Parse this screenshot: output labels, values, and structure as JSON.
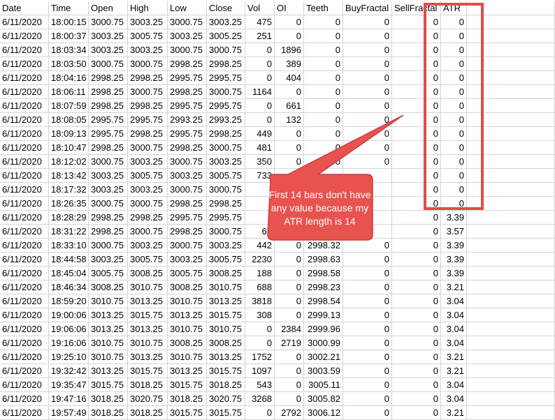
{
  "sheet": {
    "headers": [
      "Date",
      "Time",
      "Open",
      "High",
      "Low",
      "Close",
      "Vol",
      "OI",
      "Teeth",
      "BuyFractal",
      "SellFractal",
      "ATR"
    ],
    "rows": [
      [
        "6/11/2020",
        "18:00:15",
        "3000.75",
        "3003.25",
        "3000.75",
        "3003.25",
        "475",
        "0",
        "0",
        "0",
        "0",
        "0"
      ],
      [
        "6/11/2020",
        "18:00:37",
        "3003.25",
        "3005.75",
        "3003.25",
        "3005.25",
        "251",
        "0",
        "0",
        "0",
        "0",
        "0"
      ],
      [
        "6/11/2020",
        "18:03:34",
        "3003.25",
        "3003.25",
        "3000.75",
        "3000.75",
        "0",
        "1896",
        "0",
        "0",
        "0",
        "0"
      ],
      [
        "6/11/2020",
        "18:03:50",
        "3000.75",
        "3000.75",
        "2998.25",
        "2998.25",
        "0",
        "389",
        "0",
        "0",
        "0",
        "0"
      ],
      [
        "6/11/2020",
        "18:04:16",
        "2998.25",
        "2998.25",
        "2995.75",
        "2995.75",
        "0",
        "404",
        "0",
        "0",
        "0",
        "0"
      ],
      [
        "6/11/2020",
        "18:06:11",
        "2998.25",
        "3000.75",
        "2998.25",
        "3000.75",
        "1164",
        "0",
        "0",
        "0",
        "0",
        "0"
      ],
      [
        "6/11/2020",
        "18:07:59",
        "2998.25",
        "2998.25",
        "2995.75",
        "2995.75",
        "0",
        "661",
        "0",
        "0",
        "0",
        "0"
      ],
      [
        "6/11/2020",
        "18:08:05",
        "2995.75",
        "2995.75",
        "2993.25",
        "2993.25",
        "0",
        "132",
        "0",
        "0",
        "0",
        "0"
      ],
      [
        "6/11/2020",
        "18:09:13",
        "2995.75",
        "2998.25",
        "2995.75",
        "2998.25",
        "449",
        "0",
        "0",
        "0",
        "0",
        "0"
      ],
      [
        "6/11/2020",
        "18:10:47",
        "2998.25",
        "3000.75",
        "2998.25",
        "3000.75",
        "481",
        "0",
        "0",
        "0",
        "0",
        "0"
      ],
      [
        "6/11/2020",
        "18:12:02",
        "3000.75",
        "3003.25",
        "3000.75",
        "3003.25",
        "350",
        "0",
        "0",
        "0",
        "0",
        "0"
      ],
      [
        "6/11/2020",
        "18:13:42",
        "3003.25",
        "3005.75",
        "3003.25",
        "3005.75",
        "733",
        "",
        "",
        "",
        "0",
        "0"
      ],
      [
        "6/11/2020",
        "18:17:32",
        "3003.25",
        "3003.25",
        "3000.75",
        "3000.75",
        "",
        "",
        "",
        "",
        "0",
        "0"
      ],
      [
        "6/11/2020",
        "18:26:35",
        "3000.75",
        "3000.75",
        "2998.25",
        "2998.25",
        "",
        "",
        "",
        "",
        "0",
        "0"
      ],
      [
        "6/11/2020",
        "18:28:29",
        "2998.25",
        "2998.25",
        "2995.75",
        "2995.75",
        "",
        "",
        "",
        "",
        "0",
        "3.39"
      ],
      [
        "6/11/2020",
        "18:31:22",
        "2998.25",
        "3000.75",
        "2998.25",
        "3000.75",
        "67",
        "",
        "",
        "",
        "0",
        "3.57"
      ],
      [
        "6/11/2020",
        "18:33:10",
        "3000.75",
        "3003.25",
        "3000.75",
        "3003.25",
        "442",
        "0",
        "2998.32",
        "0",
        "0",
        "3.39"
      ],
      [
        "6/11/2020",
        "18:44:58",
        "3003.25",
        "3005.75",
        "3003.25",
        "3005.75",
        "2230",
        "0",
        "2998.63",
        "0",
        "0",
        "3.39"
      ],
      [
        "6/11/2020",
        "18:45:04",
        "3005.75",
        "3008.25",
        "3005.75",
        "3008.25",
        "188",
        "0",
        "2998.58",
        "0",
        "0",
        "3.39"
      ],
      [
        "6/11/2020",
        "18:46:34",
        "3008.25",
        "3010.75",
        "3008.25",
        "3010.75",
        "688",
        "0",
        "2998.23",
        "0",
        "0",
        "3.21"
      ],
      [
        "6/11/2020",
        "18:59:20",
        "3010.75",
        "3013.25",
        "3010.75",
        "3013.25",
        "3818",
        "0",
        "2998.54",
        "0",
        "0",
        "3.04"
      ],
      [
        "6/11/2020",
        "19:00:06",
        "3013.25",
        "3015.75",
        "3013.25",
        "3015.75",
        "308",
        "0",
        "2999.13",
        "0",
        "0",
        "3.04"
      ],
      [
        "6/11/2020",
        "19:06:06",
        "3013.25",
        "3013.25",
        "3010.75",
        "3010.75",
        "0",
        "2384",
        "2999.96",
        "0",
        "0",
        "3.04"
      ],
      [
        "6/11/2020",
        "19:16:06",
        "3010.75",
        "3010.75",
        "3008.25",
        "3008.25",
        "0",
        "2719",
        "3000.99",
        "0",
        "0",
        "3.04"
      ],
      [
        "6/11/2020",
        "19:25:10",
        "3010.75",
        "3013.25",
        "3010.75",
        "3013.25",
        "1752",
        "0",
        "3002.21",
        "0",
        "0",
        "3.21"
      ],
      [
        "6/11/2020",
        "19:32:42",
        "3013.25",
        "3015.75",
        "3013.25",
        "3015.75",
        "1097",
        "0",
        "3003.59",
        "0",
        "0",
        "3.21"
      ],
      [
        "6/11/2020",
        "19:35:47",
        "3015.75",
        "3018.25",
        "3015.75",
        "3018.25",
        "543",
        "0",
        "3005.11",
        "0",
        "0",
        "3.04"
      ],
      [
        "6/11/2020",
        "19:47:16",
        "3018.25",
        "3020.75",
        "3018.25",
        "3020.75",
        "3268",
        "0",
        "3005.82",
        "0",
        "0",
        "3.04"
      ],
      [
        "6/11/2020",
        "19:57:49",
        "3018.25",
        "3018.25",
        "3015.75",
        "3015.75",
        "0",
        "2792",
        "3006.12",
        "0",
        "0",
        "3.21"
      ]
    ]
  },
  "annotation": {
    "text": "First 14 bars don't have any value because my ATR length is 14"
  },
  "colors": {
    "highlight_border": "#e34b4b",
    "callout_fill": "#e8534f",
    "callout_border": "#c93d3a",
    "gridline": "#d4d4d4"
  }
}
